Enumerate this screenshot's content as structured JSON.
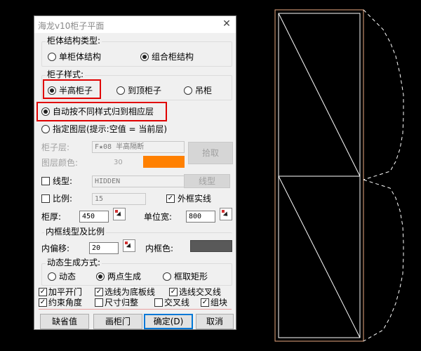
{
  "dialog": {
    "title": "海龙v10柜子平面",
    "close_icon": "close-icon",
    "structure": {
      "label": "柜体结构类型:",
      "opt_single": "单柜体结构",
      "opt_combo": "组合柜结构",
      "selected": "combo"
    },
    "style": {
      "label": "柜子样式:",
      "opt_half": "半高柜子",
      "opt_top": "到顶柜子",
      "opt_hanging": "吊柜",
      "selected": "half"
    },
    "layer_mode": {
      "opt_auto": "自动按不同样式归到相应层",
      "opt_specify": "指定图层(提示:空值 = 当前层)",
      "selected": "auto"
    },
    "cabinet_layer": {
      "label": "柜子层:",
      "value": "F★08 半高隔断",
      "pick_label": "拾取"
    },
    "layer_color": {
      "label": "图层颜色:",
      "value": "30",
      "swatch": "#ff8000"
    },
    "linetype": {
      "label": "线型:",
      "value": "HIDDEN",
      "button": "线型"
    },
    "scale": {
      "label": "比例:",
      "value": "15",
      "outer_solid_label": "外框实线"
    },
    "thickness": {
      "label": "柜厚:",
      "value": "450"
    },
    "unit_width": {
      "label": "单位宽:",
      "value": "800"
    },
    "inner": {
      "label": "内框线型及比例",
      "offset_label": "内偏移:",
      "offset_value": "20",
      "color_label": "内框色:",
      "color_swatch": "#595959"
    },
    "dynamic": {
      "label": "动态生成方式:",
      "opt_dynamic": "动态",
      "opt_two_points": "两点生成",
      "opt_rect": "框取矩形",
      "selected": "two_points"
    },
    "options": {
      "flat_door": "加平开门",
      "select_bottom": "选线为底板线",
      "select_cross": "选线交叉线",
      "constraint_angle": "约束角度",
      "size_round": "尺寸归整",
      "cross_line": "交叉线",
      "group": "组块"
    },
    "buttons": {
      "default_value": "缺省值",
      "draw_door": "画柜门",
      "ok": "确定(D)",
      "cancel": "取消"
    }
  },
  "canvas": {
    "accent_color": "#e0a080"
  }
}
